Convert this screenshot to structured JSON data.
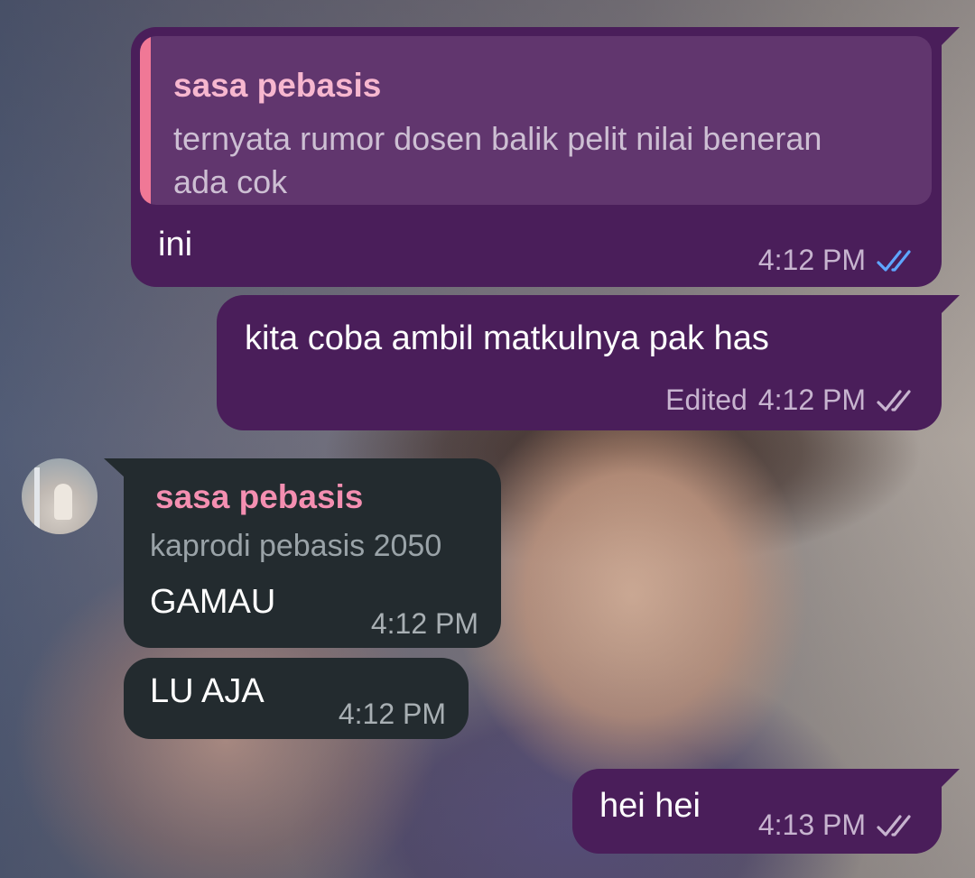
{
  "chat": {
    "accent_outgoing": "#4a1e5a",
    "accent_incoming": "#232b2f",
    "messages": [
      {
        "direction": "outgoing",
        "reply_to": {
          "name": "sasa pebasis",
          "text": "ternyata rumor dosen balik pelit nilai beneran ada cok"
        },
        "text": "ini",
        "time": "4:12 PM",
        "status": "read"
      },
      {
        "direction": "outgoing",
        "text": "kita coba ambil matkulnya pak has",
        "edited_label": "Edited",
        "time": "4:12 PM",
        "status": "delivered"
      },
      {
        "direction": "incoming",
        "sender_name": "sasa pebasis",
        "sender_title": "kaprodi pebasis 2050",
        "text": "GAMAU",
        "time": "4:12 PM"
      },
      {
        "direction": "incoming",
        "text": "LU AJA",
        "time": "4:12 PM"
      },
      {
        "direction": "outgoing",
        "text": "hei hei",
        "time": "4:13 PM",
        "status": "delivered"
      }
    ]
  },
  "icons": {
    "read_ticks_color": "#5ea6ff",
    "delivered_ticks_color": "#c7b4cf"
  }
}
